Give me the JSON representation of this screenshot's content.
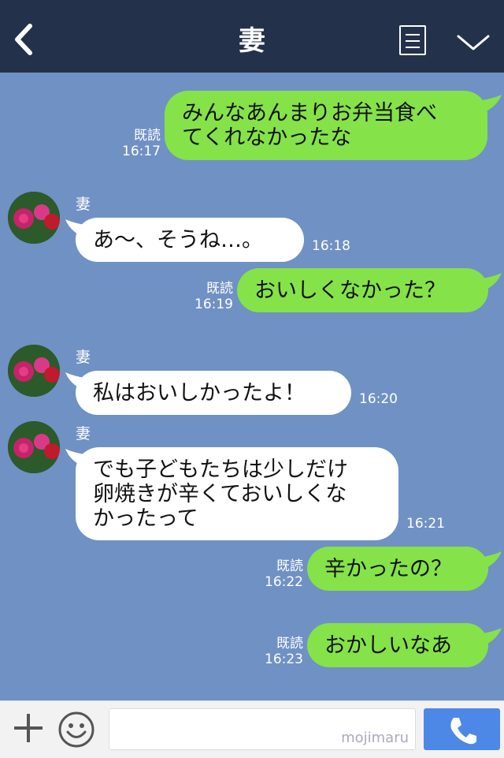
{
  "header": {
    "title": "妻",
    "back_icon": "back-chevron-icon",
    "menu_icon": "menu-list-icon",
    "collapse_icon": "chevron-down-icon"
  },
  "colors": {
    "header_bg": "#24314a",
    "chat_bg": "#7091c4",
    "outgoing_bubble": "#85e249",
    "incoming_bubble": "#ffffff",
    "call_button": "#4e88e6"
  },
  "messages": [
    {
      "direction": "out",
      "lines": [
        "みんなあんまりお弁当食べ",
        "てくれなかったな"
      ],
      "read": "既読",
      "time": "16:17"
    },
    {
      "direction": "in",
      "sender": "妻",
      "lines": [
        "あ～、そうね…。"
      ],
      "time": "16:18"
    },
    {
      "direction": "out",
      "lines": [
        "おいしくなかった？"
      ],
      "read": "既読",
      "time": "16:19"
    },
    {
      "direction": "in",
      "sender": "妻",
      "lines": [
        "私はおいしかったよ！"
      ],
      "time": "16:20"
    },
    {
      "direction": "in",
      "sender": "妻",
      "lines": [
        "でも子どもたちは少しだけ",
        "卵焼きが辛くておいしくな",
        "かったって"
      ],
      "time": "16:21"
    },
    {
      "direction": "out",
      "lines": [
        "辛かったの？"
      ],
      "read": "既読",
      "time": "16:22"
    },
    {
      "direction": "out",
      "lines": [
        "おかしいなあ"
      ],
      "read": "既読",
      "time": "16:23"
    }
  ],
  "footer": {
    "plus_icon": "plus-icon",
    "sticker_icon": "smiley-icon",
    "input_value": "",
    "watermark": "mojimaru",
    "call_icon": "phone-icon"
  }
}
